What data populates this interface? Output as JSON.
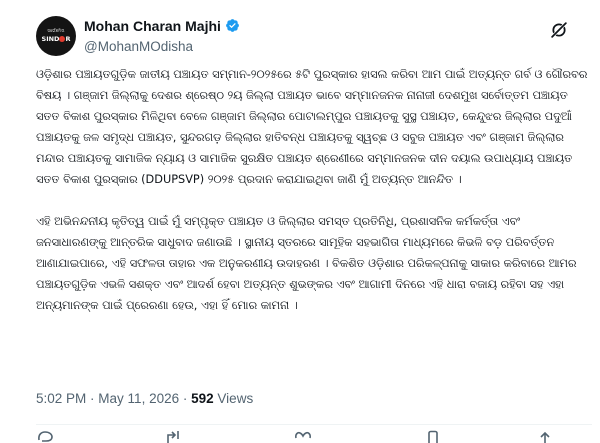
{
  "author": {
    "display_name": "Mohan Charan Majhi",
    "handle": "@MohanMOdisha",
    "verified": true,
    "avatar": {
      "top_text": "ସର୍ଭେଞ୍ଚମିତା",
      "brand_text_before": "SIND",
      "brand_text_after": "R"
    }
  },
  "post": {
    "paragraph_1": [
      "ଓଡ଼ିଶାର ପଞ୍ଚାୟତଗୁଡ଼ିକ ଜାତୀୟ ପଞ୍ଚାୟତ ସମ୍ମାନ-୨୦୨୫ରେ ୫ଟି ପୁରସ୍କାର ହାସଲ କରିବା ଆମ ପାଇଁ",
      "ଅତ୍ୟନ୍ତ ଗର୍ବ ଓ ଗୌରବର ବିଷୟ । ଗଞ୍ଜାମ ଜିଲ୍ଲାକୁ ଦେଶର ଶ୍ରେଷ୍ଠ ୨ୟ ଜିଲ୍ଲା ପଞ୍ଚାୟତ ଭାବେ ସମ୍ମାନଜନକ",
      "ନାନାଜୀ ଦେଶମୁଖ ସର୍ବୋତ୍ତମ ପଞ୍ଚାୟତ ସତତ ବିକାଶ ପୁରସ୍କାର ମିଳିଥିବା ବେଳେ ଗଞ୍ଜାମ ଜିଲ୍ଲାର",
      "ପୋଟାଲମ୍ପୁର ପଞ୍ଚାୟତକୁ ସୁସ୍ଥ ପଞ୍ଚାୟତ, କେନ୍ଦୁଝର ଜିଲ୍ଲାର ପଦୁଆଁ ପଞ୍ଚାୟତକୁ ଜଳ ସମୃଦ୍ଧ ପଞ୍ଚାୟତ,",
      "ସୁନ୍ଦରଗଡ଼ ଜିଲ୍ଲାର ହାତିବନ୍ଧ ପଞ୍ଚାୟତକୁ ସ୍ୱଚ୍ଛ ଓ ସବୁଜ ପଞ୍ଚାୟତ ଏବଂ ଗଞ୍ଜାମ ଜିଲ୍ଲାର ମନ୍ଦାର ପଞ୍ଚାୟତକୁ",
      "ସାମାଜିକ ନ୍ୟାୟ ଓ ସାମାଜିକ ସୁରକ୍ଷିତ ପଞ୍ଚାୟତ ଶ୍ରେଣୀରେ ସମ୍ମାନଜନକ ଦୀନ ଦୟାଲ ଉପାଧ୍ୟାୟ ପଞ୍ଚାୟତ",
      "ସତତ ବିକାଶ ପୁରସ୍କାର (DDUPSVP) ୨୦୨୫ ପ୍ରଦାନ କରାଯାଇଥିବା ଜାଣି ମୁଁ ଅତ୍ୟନ୍ତ ଆନନ୍ଦିତ ।"
    ],
    "paragraph_2": [
      "ଏହି ଅଭିନନ୍ଦନୀୟ କୃତିତ୍ୱ ପାଇଁ ମୁଁ ସମ୍ପୃକ୍ତ ପଞ୍ଚାୟତ ଓ ଜିଲ୍ଲାର ସମସ୍ତ ପ୍ରତିନିଧି, ପ୍ରଶାସନିକ କର୍ମକର୍ତ୍ତା ଏବଂ",
      "ଜନସାଧାରଣଙ୍କୁ ଆନ୍ତରିକ ସାଧୁବାଦ ଜଣାଉଛି । ସ୍ଥାନୀୟ ସ୍ତରରେ ସାମୂହିକ ସହଭାଗିତା ମାଧ୍ୟମରେ କିଭଳି",
      "ବଡ଼ ପରିବର୍ତ୍ତନ ଆଣାଯାଇପାରେ, ଏହି ସଫଳତା ତାହାର ଏକ ଅନୁକରଣୀୟ ଉଦାହରଣ । ବିକଶିତ ଓଡ଼ିଶାର",
      "ପରିକଳ୍ପନାକୁ ସାକାର କରିବାରେ ଆମର ପଞ୍ଚାୟତଗୁଡ଼ିକ ଏଭଳି ସଶକ୍ତ ଏବଂ ଆଦର୍ଶ ହେବା ଅତ୍ୟନ୍ତ ଶୁଭଙ୍କର",
      "ଏବଂ ଆଗାମୀ ଦିନରେ ଏହି ଧାରା ବଜାୟ ରହିବା ସହ ଏହା ଅନ୍ୟମାନଙ୍କ ପାଇଁ ପ୍ରେରଣା ହେଉ, ଏହା ହିଁ",
      "ମୋର କାମନା ।"
    ],
    "time": "5:02 PM",
    "date": "May 11, 2026",
    "views_count": "592",
    "views_label": "Views"
  },
  "colors": {
    "text": "#0f1419",
    "secondary": "#536471",
    "verified_blue": "#1d9bf0",
    "divider": "#eff3f4",
    "avatar_bg": "#141414",
    "avatar_accent": "#e23b2e"
  },
  "icons": {
    "verified": "verified-badge-icon",
    "grok": "grok-icon",
    "reply": "reply-icon",
    "repost": "repost-icon",
    "like": "like-icon",
    "bookmark": "bookmark-icon",
    "share": "share-icon"
  }
}
